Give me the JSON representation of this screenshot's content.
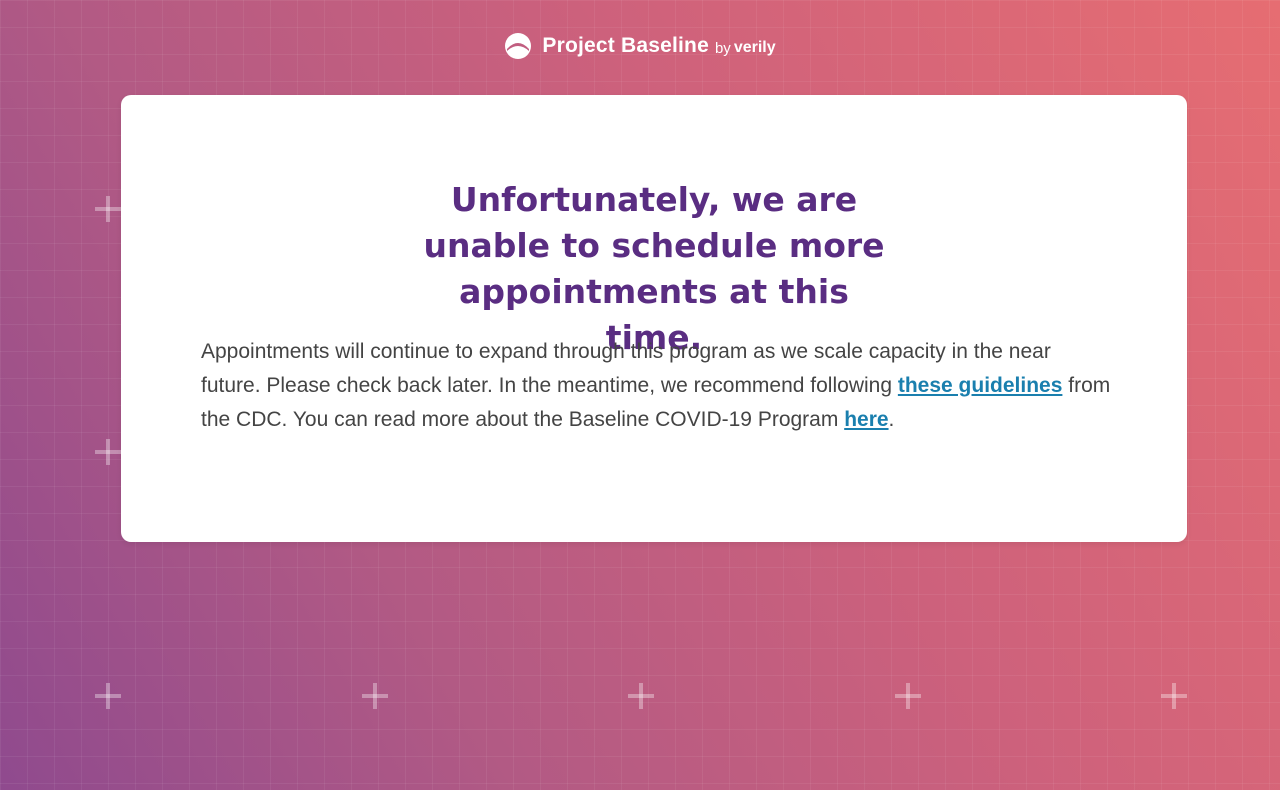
{
  "header": {
    "logo_icon": "project-baseline-logo-icon",
    "brand_name": "Project Baseline",
    "by": "by",
    "partner": "verily"
  },
  "card": {
    "title": "Unfortunately, we are unable to schedule more appointments at this time.",
    "body": {
      "text_1": "Appointments will continue to expand through this program as we scale capacity in the near future.  Please check back later. In the meantime, we recommend following ",
      "link_1": "these guidelines",
      "text_2": " from the CDC. You can read more about the Baseline COVID-19 Program ",
      "link_2": "here",
      "text_3": "."
    }
  },
  "colors": {
    "title": "#5a2d82",
    "link": "#1a7fae",
    "body_text": "#444444",
    "gradient_start": "#8f4a8e",
    "gradient_end": "#e66d72"
  },
  "decorations": {
    "icon": "plus-icon"
  }
}
